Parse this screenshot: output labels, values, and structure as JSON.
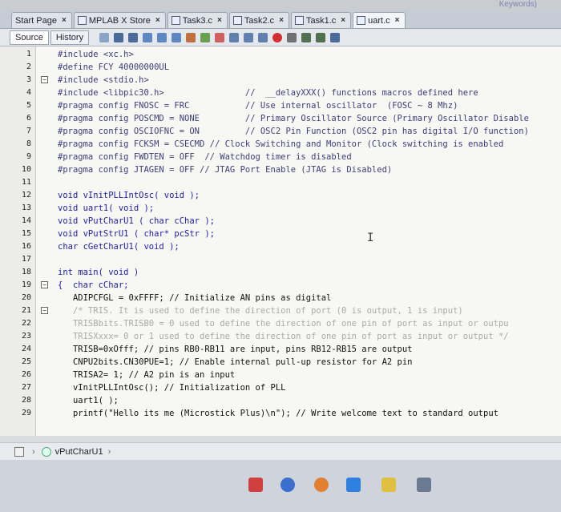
{
  "top_partial_text": "Keywords)",
  "tabs": [
    {
      "label": "Start Page",
      "active": false
    },
    {
      "label": "MPLAB X Store",
      "active": false
    },
    {
      "label": "Task3.c",
      "active": false
    },
    {
      "label": "Task2.c",
      "active": false
    },
    {
      "label": "Task1.c",
      "active": false
    },
    {
      "label": "uart.c",
      "active": true
    }
  ],
  "toolbar": {
    "source_label": "Source",
    "history_label": "History"
  },
  "code_lines": [
    {
      "num": "1",
      "text": "#include <xc.h>"
    },
    {
      "num": "2",
      "text": "#define FCY 40000000UL"
    },
    {
      "num": "3",
      "text": "#include <stdio.h>"
    },
    {
      "num": "4",
      "text": "#include <libpic30.h>                //  __delayXXX() functions macros defined here"
    },
    {
      "num": "5",
      "text": "#pragma config FNOSC = FRC           // Use internal oscillator  (FOSC ~ 8 Mhz)"
    },
    {
      "num": "6",
      "text": "#pragma config POSCMD = NONE         // Primary Oscillator Source (Primary Oscillator Disable"
    },
    {
      "num": "7",
      "text": "#pragma config OSCIOFNC = ON         // OSC2 Pin Function (OSC2 pin has digital I/O function)"
    },
    {
      "num": "8",
      "text": "#pragma config FCKSM = CSECMD // Clock Switching and Monitor (Clock switching is enabled"
    },
    {
      "num": "9",
      "text": "#pragma config FWDTEN = OFF  // Watchdog timer is disabled"
    },
    {
      "num": "10",
      "text": "#pragma config JTAGEN = OFF // JTAG Port Enable (JTAG is Disabled)"
    },
    {
      "num": "11",
      "text": ""
    },
    {
      "num": "12",
      "text": "void vInitPLLIntOsc( void );"
    },
    {
      "num": "13",
      "text": "void uart1( void );"
    },
    {
      "num": "14",
      "text": "void vPutCharU1 ( char cChar );"
    },
    {
      "num": "15",
      "text": "void vPutStrU1 ( char* pcStr );"
    },
    {
      "num": "16",
      "text": "char cGetCharU1( void );"
    },
    {
      "num": "17",
      "text": ""
    },
    {
      "num": "18",
      "text": "int main( void )"
    },
    {
      "num": "19",
      "text": "{  char cChar;"
    },
    {
      "num": "20",
      "text": "   ADIPCFGL = 0xFFFF; // Initialize AN pins as digital"
    },
    {
      "num": "21",
      "text": "   /* TRIS. It is used to define the direction of port (0 is output, 1 is input)"
    },
    {
      "num": "22",
      "text": "   TRISBbits.TRISB0 = 0 used to define the direction of one pin of port as input or outpu"
    },
    {
      "num": "23",
      "text": "   TRISXxxx= 0 or 1 used to define the direction of one pin of port as input or output */"
    },
    {
      "num": "24",
      "text": "   TRISB=0xOfff; // pins RB0-RB11 are input, pins RB12-RB15 are output"
    },
    {
      "num": "25",
      "text": "   CNPU2bits.CN30PUE=1; // Enable internal pull-up resistor for A2 pin"
    },
    {
      "num": "26",
      "text": "   TRISA2= 1; // A2 pin is an input"
    },
    {
      "num": "27",
      "text": "   vInitPLLIntOsc(); // Initialization of PLL"
    },
    {
      "num": "28",
      "text": "   uart1( );"
    },
    {
      "num": "29",
      "text": "   printf(\"Hello its me (Microstick Plus)\\n\"); // Write welcome text to standard output"
    }
  ],
  "scroll_left_arrow": "<",
  "nav": {
    "function_label": "vPutCharU1"
  },
  "icons": {
    "tab_close": "close-icon",
    "fold": "fold-toggle-icon",
    "nav_chevron": "chevron-right-icon"
  }
}
